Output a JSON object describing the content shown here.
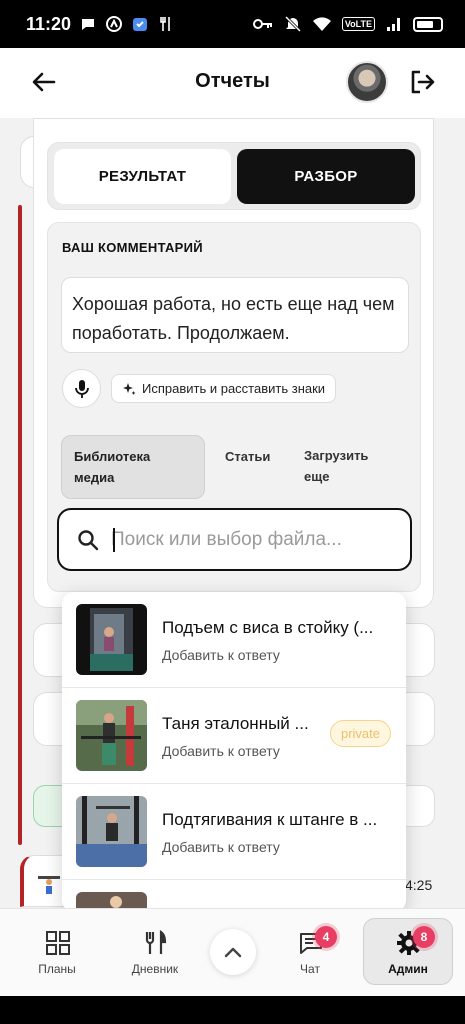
{
  "status_bar": {
    "time": "11:20",
    "network": "VoLTE"
  },
  "header": {
    "title": "Отчеты"
  },
  "segments": {
    "result": "РЕЗУЛЬТАТ",
    "review": "РАЗБОР"
  },
  "comment": {
    "label": "ВАШ КОММЕНТАРИЙ",
    "text": "Хорошая работа, но есть еще над чем поработать. Продолжаем.",
    "fix_button": "Исправить и расставить знаки"
  },
  "media_tabs": {
    "library": "Библиотека медиа",
    "articles": "Статьи",
    "upload": "Загрузить еще"
  },
  "search": {
    "placeholder": "Поиск или выбор файла..."
  },
  "results": [
    {
      "title": "Подъем с виса в стойку (...",
      "subtitle": "Добавить к ответу"
    },
    {
      "title": "Таня эталонный ...",
      "subtitle": "Добавить к ответу",
      "tag": "private"
    },
    {
      "title": "Подтягивания к штанге в ...",
      "subtitle": "Добавить к ответу"
    }
  ],
  "background": {
    "time_fragment": "4:25"
  },
  "nav": {
    "plans": "Планы",
    "diary": "Дневник",
    "chat": "Чат",
    "chat_badge": "4",
    "admin": "Админ",
    "admin_badge": "8"
  },
  "colors": {
    "accent": "#111111",
    "badge": "#e83e63",
    "private": "#e9c26a",
    "stripe": "#b32525"
  }
}
